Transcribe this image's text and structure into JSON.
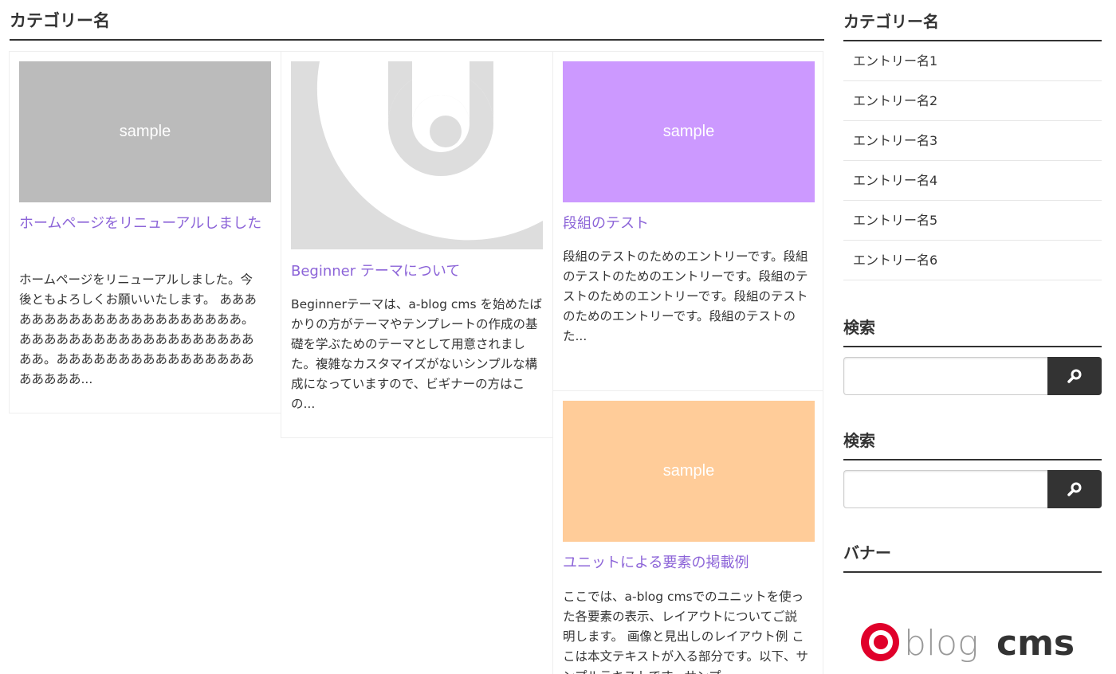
{
  "main": {
    "heading": "カテゴリー名",
    "cards": [
      {
        "thumb_label": "sample",
        "thumb_color": "#bbbbbb",
        "title": "ホームページをリニューアルしました",
        "excerpt": "ホームページをリニューアルしました。今後ともよろしくお願いいたします。 あああああああああああああああああああああ。あああああああああああああああああああああ。あああああああああああああああああああああ..."
      },
      {
        "thumb_label": "",
        "thumb_color": "#dddddd",
        "title": "Beginner テーマについて",
        "excerpt": "Beginnerテーマは、a-blog cms を始めたばかりの方がテーマやテンプレートの作成の基礎を学ぶためのテーマとして用意されました。複雑なカスタマイズがないシンプルな構成になっていますので、ビギナーの方はこの..."
      },
      {
        "thumb_label": "sample",
        "thumb_color": "#cc99ff",
        "title": "段組のテスト",
        "excerpt": "段組のテストのためのエントリーです。段組のテストのためのエントリーです。段組のテストのためのエントリーです。段組のテストのためのエントリーです。段組のテストのた..."
      },
      {
        "thumb_label": "sample",
        "thumb_color": "#ffcc99",
        "title": "ユニットによる要素の掲載例",
        "excerpt": "ここでは、a-blog cmsでのユニットを使った各要素の表示、レイアウトについてご説明します。 画像と見出しのレイアウト例 ここは本文テキストが入る部分です。以下、サンプルテキストです。サンプ"
      }
    ]
  },
  "sidebar": {
    "category_heading": "カテゴリー名",
    "entries": [
      "エントリー名1",
      "エントリー名2",
      "エントリー名3",
      "エントリー名4",
      "エントリー名5",
      "エントリー名6"
    ],
    "search1_heading": "検索",
    "search2_heading": "検索",
    "banner_heading": "バナー",
    "banner_logo": "a-blog cms"
  },
  "colors": {
    "link": "#8c64d8",
    "text": "#333333",
    "accent_red": "#e0002a"
  },
  "icons": {
    "search_button": "magnifier-icon"
  }
}
